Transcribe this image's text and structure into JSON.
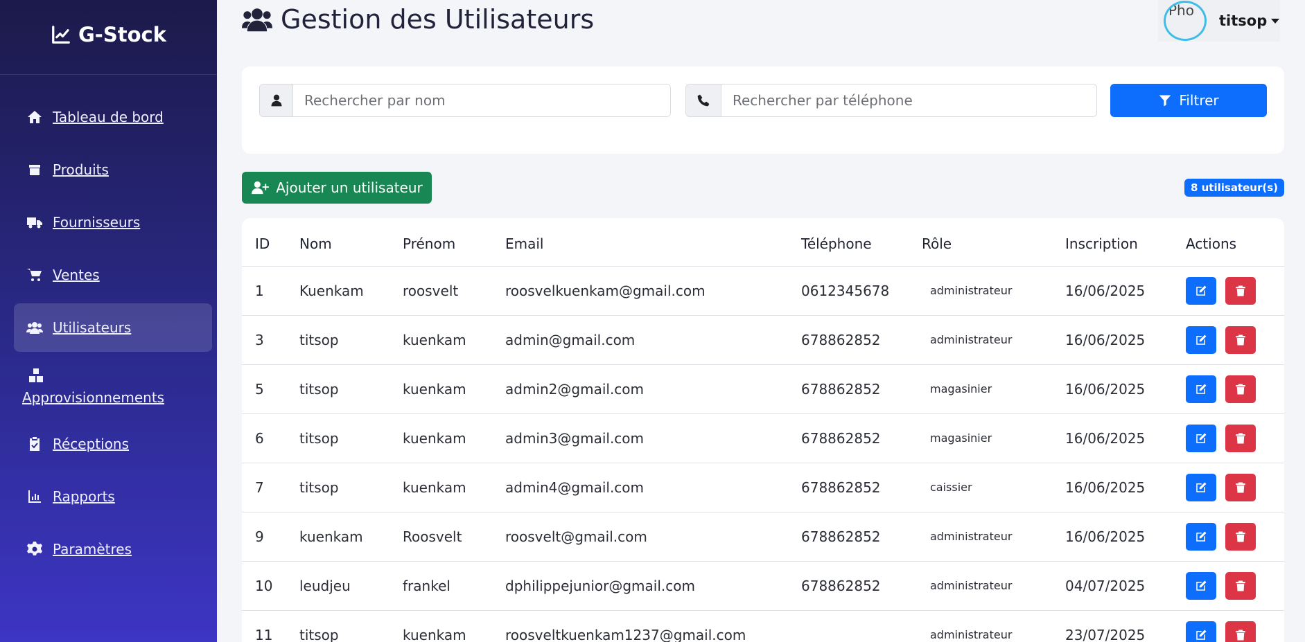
{
  "sidebar": {
    "brand": "G-Stock",
    "items": [
      {
        "label": "Tableau de bord",
        "icon": "home-icon"
      },
      {
        "label": "Produits",
        "icon": "box-icon"
      },
      {
        "label": "Fournisseurs",
        "icon": "truck-icon"
      },
      {
        "label": "Ventes",
        "icon": "cart-icon"
      },
      {
        "label": "Utilisateurs",
        "icon": "users-icon",
        "active": true
      },
      {
        "label": "Approvisionnements",
        "icon": "boxes-icon"
      },
      {
        "label": "Réceptions",
        "icon": "clipboard-check-icon"
      },
      {
        "label": "Rapports",
        "icon": "chart-icon"
      },
      {
        "label": "Paramètres",
        "icon": "gear-icon"
      }
    ]
  },
  "header": {
    "title": "Gestion des Utilisateurs",
    "avatar_alt": "Pho",
    "username": "titsop"
  },
  "filters": {
    "name_placeholder": "Rechercher par nom",
    "phone_placeholder": "Rechercher par téléphone",
    "filter_label": "Filtrer"
  },
  "actions": {
    "add_label": "Ajouter un utilisateur",
    "count_badge": "8 utilisateur(s)"
  },
  "table": {
    "headers": [
      "ID",
      "Nom",
      "Prénom",
      "Email",
      "Téléphone",
      "Rôle",
      "Inscription",
      "Actions"
    ],
    "rows": [
      [
        "1",
        "Kuenkam",
        "roosvelt",
        "roosvelkuenkam@gmail.com",
        "0612345678",
        "administrateur",
        "16/06/2025"
      ],
      [
        "3",
        "titsop",
        "kuenkam",
        "admin@gmail.com",
        "678862852",
        "administrateur",
        "16/06/2025"
      ],
      [
        "5",
        "titsop",
        "kuenkam",
        "admin2@gmail.com",
        "678862852",
        "magasinier",
        "16/06/2025"
      ],
      [
        "6",
        "titsop",
        "kuenkam",
        "admin3@gmail.com",
        "678862852",
        "magasinier",
        "16/06/2025"
      ],
      [
        "7",
        "titsop",
        "kuenkam",
        "admin4@gmail.com",
        "678862852",
        "caissier",
        "16/06/2025"
      ],
      [
        "9",
        "kuenkam",
        "Roosvelt",
        "roosvelt@gmail.com",
        "678862852",
        "administrateur",
        "16/06/2025"
      ],
      [
        "10",
        "leudjeu",
        "frankel",
        "dphilippejunior@gmail.com",
        "678862852",
        "administrateur",
        "04/07/2025"
      ],
      [
        "11",
        "titsop",
        "kuenkam",
        "roosveltkuenkam1237@gmail.com",
        "",
        "administrateur",
        "23/07/2025"
      ]
    ]
  },
  "colors": {
    "primary": "#0d6efd",
    "success": "#198754",
    "danger": "#dc3545",
    "sidebar_top": "#1c1a4a",
    "sidebar_bottom": "#3d35c4"
  }
}
